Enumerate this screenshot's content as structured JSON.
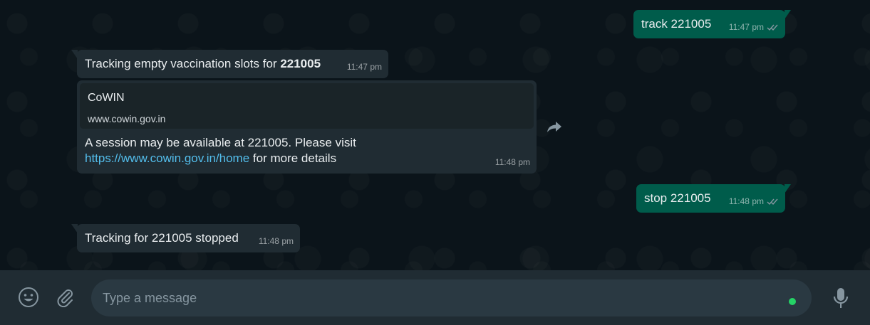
{
  "messages": [
    {
      "direction": "out",
      "text": "track 221005",
      "time": "11:47 pm"
    },
    {
      "direction": "in",
      "text_prefix": "Tracking empty vaccination slots for ",
      "text_bold": "221005",
      "time": "11:47 pm"
    },
    {
      "direction": "in",
      "preview_title": "CoWIN",
      "preview_url": "www.cowin.gov.in",
      "body_line1": "A session may be available at 221005. Please visit",
      "link_text": "https://www.cowin.gov.in/home",
      "body_suffix": " for more details",
      "time": "11:48 pm"
    },
    {
      "direction": "out",
      "text": "stop 221005",
      "time": "11:48 pm"
    },
    {
      "direction": "in",
      "text": "Tracking for 221005 stopped",
      "time": "11:48 pm"
    }
  ],
  "composer": {
    "placeholder": "Type a message",
    "value": ""
  },
  "icons": {
    "emoji": "emoji-icon",
    "attach": "paperclip-icon",
    "mic": "microphone-icon",
    "forward": "forward-icon",
    "read_receipt": "double-check-icon"
  },
  "colors": {
    "outgoing_bubble": "#005c4b",
    "incoming_bubble": "#202c33",
    "link": "#53bdeb",
    "footer": "#202c33",
    "input": "#2a3942",
    "status_dot": "#25d366"
  }
}
